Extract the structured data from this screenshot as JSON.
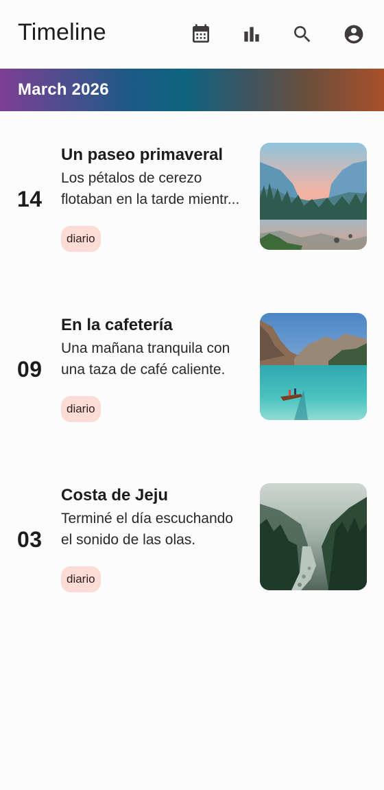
{
  "appbar": {
    "title": "Timeline",
    "icons": [
      "calendar-icon",
      "bar-chart-icon",
      "search-icon",
      "account-circle-icon"
    ]
  },
  "month": {
    "label": "March 2026"
  },
  "entries": [
    {
      "day": "14",
      "title": "Un paseo primaveral",
      "text_lines": [
        "Los pétalos de cerezo",
        "flotaban en la tarde mientr..."
      ],
      "tag": "diario",
      "thumbnail": "mountain-valley-sunset"
    },
    {
      "day": "09",
      "title": "En la cafetería",
      "text_lines": [
        "Una mañana tranquila con",
        "una taza de café caliente."
      ],
      "tag": "diario",
      "thumbnail": "turquoise-lake-boat"
    },
    {
      "day": "03",
      "title": "Costa de Jeju",
      "text_lines": [
        "Terminé el día escuchando",
        "el sonido de las olas."
      ],
      "tag": "diario",
      "thumbnail": "misty-forest-river"
    }
  ],
  "colors": {
    "background": "#fdfcfc",
    "text": "#1d1b1d",
    "tag_bg": "#fcdcd5",
    "band_start": "#7c3f91",
    "band_mid": "#0f6480",
    "band_end": "#a8502a"
  }
}
